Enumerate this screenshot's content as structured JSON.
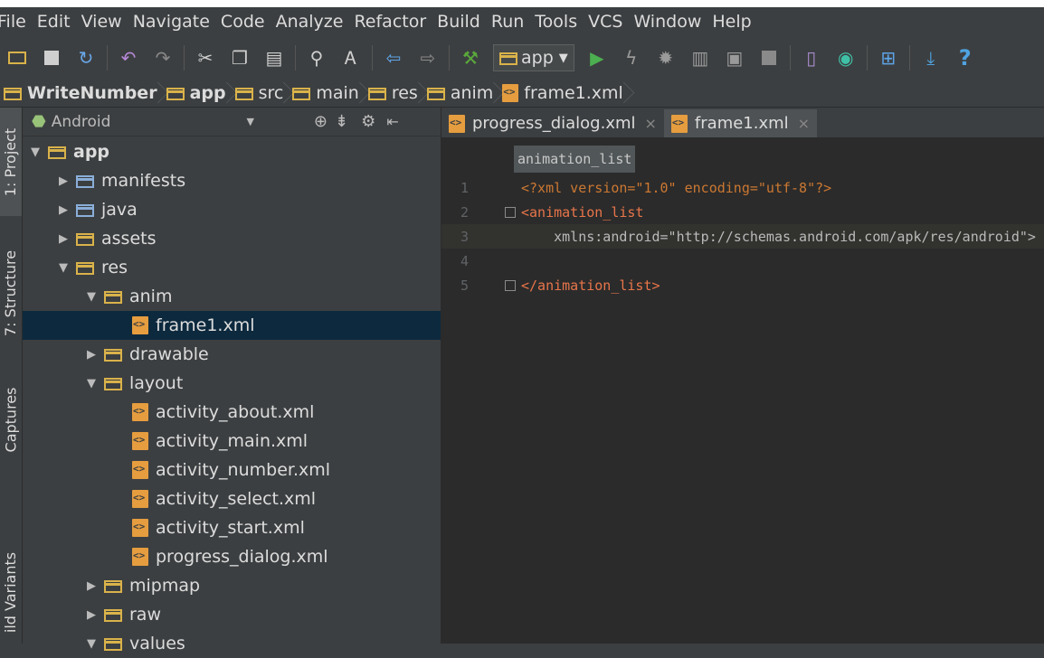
{
  "menu": [
    "File",
    "Edit",
    "View",
    "Navigate",
    "Code",
    "Analyze",
    "Refactor",
    "Build",
    "Run",
    "Tools",
    "VCS",
    "Window",
    "Help"
  ],
  "toolbar": {
    "run_config": "app",
    "icons": [
      "open-folder-icon",
      "save-icon",
      "sync-icon",
      "undo-icon",
      "redo-icon",
      "cut-icon",
      "copy-icon",
      "paste-icon",
      "find-icon",
      "replace-icon",
      "back-icon",
      "forward-icon",
      "build-hammer-icon",
      "run-icon",
      "apply-changes-icon",
      "debug-icon",
      "profile-icon",
      "attach-debugger-icon",
      "stop-icon",
      "avd-manager-icon",
      "sdk-manager-icon",
      "project-structure-icon",
      "sync-gradle-icon",
      "help-icon"
    ]
  },
  "breadcrumb": [
    "WriteNumber",
    "app",
    "src",
    "main",
    "res",
    "anim",
    "frame1.xml"
  ],
  "side_tabs": {
    "project": "1: Project",
    "structure": "7: Structure",
    "captures": "Captures",
    "variants": "ild Variants"
  },
  "project_panel": {
    "view_selector": "Android"
  },
  "tree": [
    {
      "label": "app",
      "depth": 0,
      "expanded": true,
      "icon": "module-folder-icon"
    },
    {
      "label": "manifests",
      "depth": 1,
      "expanded": false,
      "icon": "folder-icon"
    },
    {
      "label": "java",
      "depth": 1,
      "expanded": false,
      "icon": "folder-icon"
    },
    {
      "label": "assets",
      "depth": 1,
      "expanded": false,
      "icon": "resource-folder-icon"
    },
    {
      "label": "res",
      "depth": 1,
      "expanded": true,
      "icon": "resource-folder-icon"
    },
    {
      "label": "anim",
      "depth": 2,
      "expanded": true,
      "icon": "folder-icon"
    },
    {
      "label": "frame1.xml",
      "depth": 3,
      "expanded": null,
      "icon": "xml-file-icon",
      "selected": true
    },
    {
      "label": "drawable",
      "depth": 2,
      "expanded": false,
      "icon": "folder-icon"
    },
    {
      "label": "layout",
      "depth": 2,
      "expanded": true,
      "icon": "folder-icon"
    },
    {
      "label": "activity_about.xml",
      "depth": 3,
      "expanded": null,
      "icon": "xml-file-icon"
    },
    {
      "label": "activity_main.xml",
      "depth": 3,
      "expanded": null,
      "icon": "xml-file-icon"
    },
    {
      "label": "activity_number.xml",
      "depth": 3,
      "expanded": null,
      "icon": "xml-file-icon"
    },
    {
      "label": "activity_select.xml",
      "depth": 3,
      "expanded": null,
      "icon": "xml-file-icon"
    },
    {
      "label": "activity_start.xml",
      "depth": 3,
      "expanded": null,
      "icon": "xml-file-icon"
    },
    {
      "label": "progress_dialog.xml",
      "depth": 3,
      "expanded": null,
      "icon": "xml-file-icon"
    },
    {
      "label": "mipmap",
      "depth": 2,
      "expanded": false,
      "icon": "folder-icon"
    },
    {
      "label": "raw",
      "depth": 2,
      "expanded": false,
      "icon": "folder-icon"
    },
    {
      "label": "values",
      "depth": 2,
      "expanded": true,
      "icon": "folder-icon"
    }
  ],
  "editor": {
    "tabs": [
      {
        "label": "progress_dialog.xml",
        "close": "×",
        "active": false
      },
      {
        "label": "frame1.xml",
        "close": "×",
        "active": true
      }
    ],
    "code_breadcrumb": "animation_list",
    "lines": [
      {
        "num": "1",
        "text": "<?xml version=\"1.0\" encoding=\"utf-8\"?>"
      },
      {
        "num": "2",
        "text": "<animation_list"
      },
      {
        "num": "3",
        "text": "    xmlns:android=\"http://schemas.android.com/apk/res/android\">"
      },
      {
        "num": "4",
        "text": ""
      },
      {
        "num": "5",
        "text": "</animation_list>"
      }
    ]
  }
}
